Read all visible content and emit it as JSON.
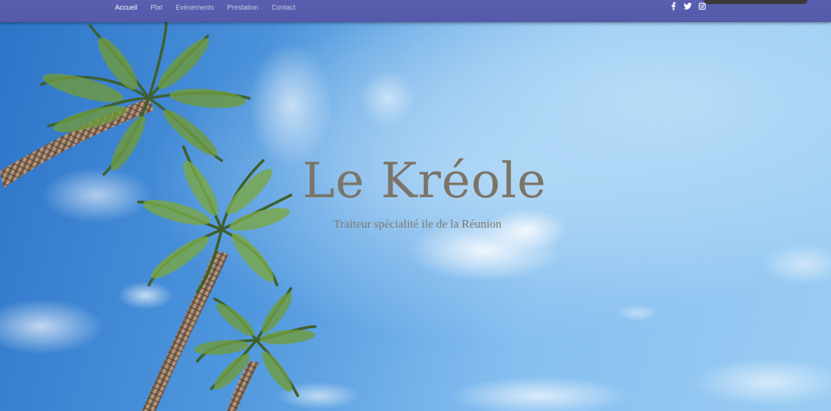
{
  "nav": {
    "links": [
      {
        "label": "Accueil",
        "active": true
      },
      {
        "label": "Plat",
        "active": false
      },
      {
        "label": "Evénements",
        "active": false
      },
      {
        "label": "Prestation",
        "active": false
      },
      {
        "label": "Contact",
        "active": false
      }
    ],
    "social_icons": [
      "facebook-icon",
      "twitter-icon",
      "instagram-icon"
    ]
  },
  "hero": {
    "title": "Le Kréole",
    "subtitle": "Traiteur spécialité ile de la Réunion"
  },
  "colors": {
    "navbar": "#5559a9",
    "title": "#7c7468",
    "sky": "#4f97dd"
  }
}
